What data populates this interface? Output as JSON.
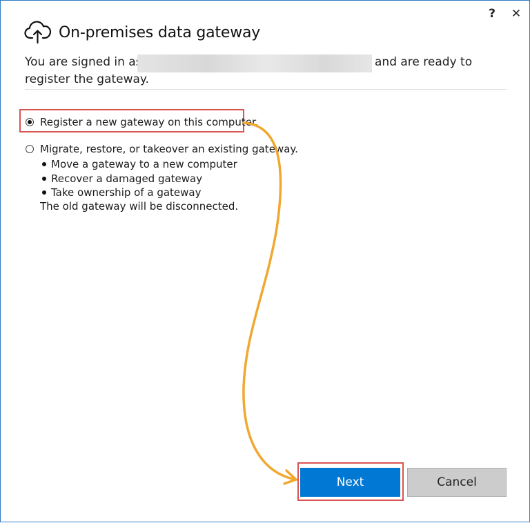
{
  "window": {
    "title": "On-premises data gateway",
    "help_label": "?",
    "close_label": "✕"
  },
  "signin": {
    "prefix": "You are signed in as",
    "suffix": "and are ready to",
    "line2": "register the gateway."
  },
  "options": {
    "register": {
      "label": "Register a new gateway on this computer.",
      "selected": true
    },
    "migrate": {
      "label": "Migrate, restore, or takeover an existing gateway.",
      "selected": false,
      "bullets": [
        "Move a gateway to a new computer",
        "Recover a damaged gateway",
        "Take ownership of a gateway"
      ],
      "note": "The old gateway will be disconnected."
    }
  },
  "buttons": {
    "next_label": "Next",
    "cancel_label": "Cancel"
  },
  "colors": {
    "accent": "#0078d4",
    "annotation_box": "#d9534f",
    "annotation_arrow": "#f0a830"
  },
  "icons": {
    "app": "cloud-upload-icon"
  }
}
